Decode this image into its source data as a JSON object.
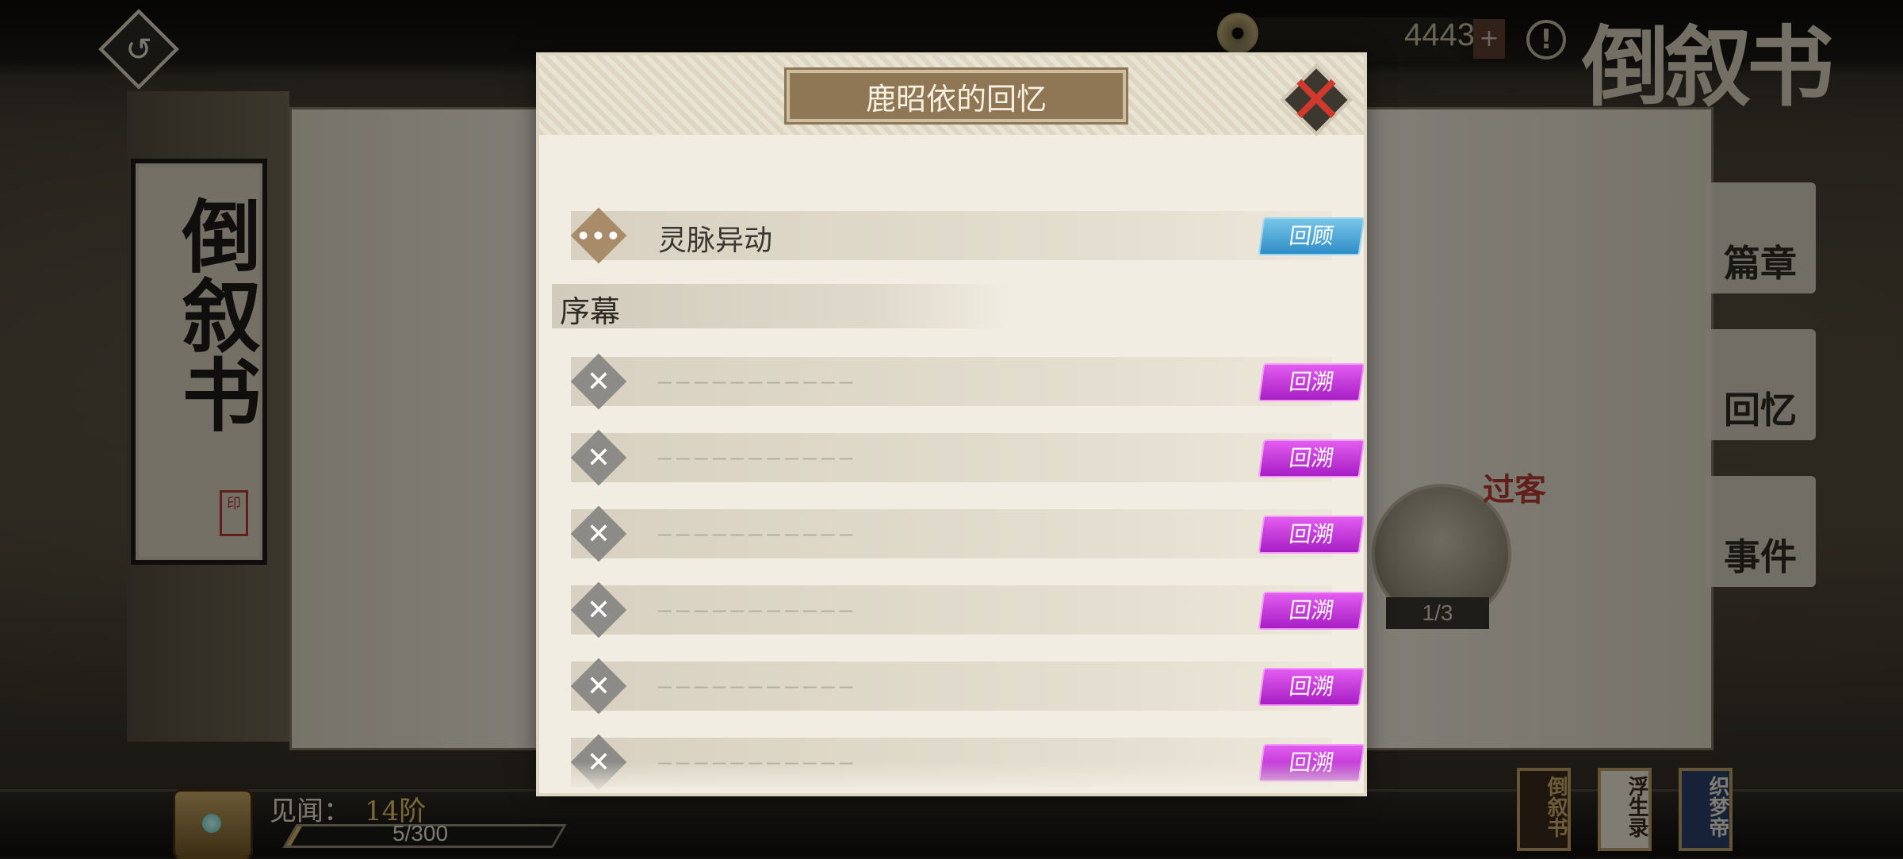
{
  "hud": {
    "currency_value": "4443",
    "currency_plus": "+",
    "info_symbol": "!",
    "back_symbol": "↺",
    "brand_logo": "倒叙书"
  },
  "background": {
    "scroll_title": "倒叙书",
    "seal": "印",
    "side_tabs": [
      {
        "label": "篇章",
        "icon": "book-icon"
      },
      {
        "label": "回忆",
        "icon": "cloud-icon"
      },
      {
        "label": "事件",
        "icon": "scroll-icon"
      }
    ],
    "npc_tag": "过客",
    "npc_progress": "1/3"
  },
  "modal": {
    "title": "鹿昭依的回忆",
    "close_symbol": "✕",
    "unlocked_item": {
      "title": "灵脉异动",
      "badge": "•••",
      "button": "回顾"
    },
    "section_title": "序幕",
    "locked_placeholder": "———————————",
    "locked_items": [
      {
        "badge": "✕",
        "button": "回溯"
      },
      {
        "badge": "✕",
        "button": "回溯"
      },
      {
        "badge": "✕",
        "button": "回溯"
      },
      {
        "badge": "✕",
        "button": "回溯"
      },
      {
        "badge": "✕",
        "button": "回溯"
      },
      {
        "badge": "✕",
        "button": "回溯"
      }
    ]
  },
  "footer": {
    "exp_label": "见闻：",
    "exp_level": "14阶",
    "exp_progress_text": "5/300",
    "exp_fraction": 0.017,
    "books": [
      "倒叙书",
      "浮生录",
      "织梦帝"
    ]
  },
  "colors": {
    "accent_blue": "#2e8dc8",
    "accent_purple": "#a71ec4",
    "close_red": "#d0392b"
  }
}
